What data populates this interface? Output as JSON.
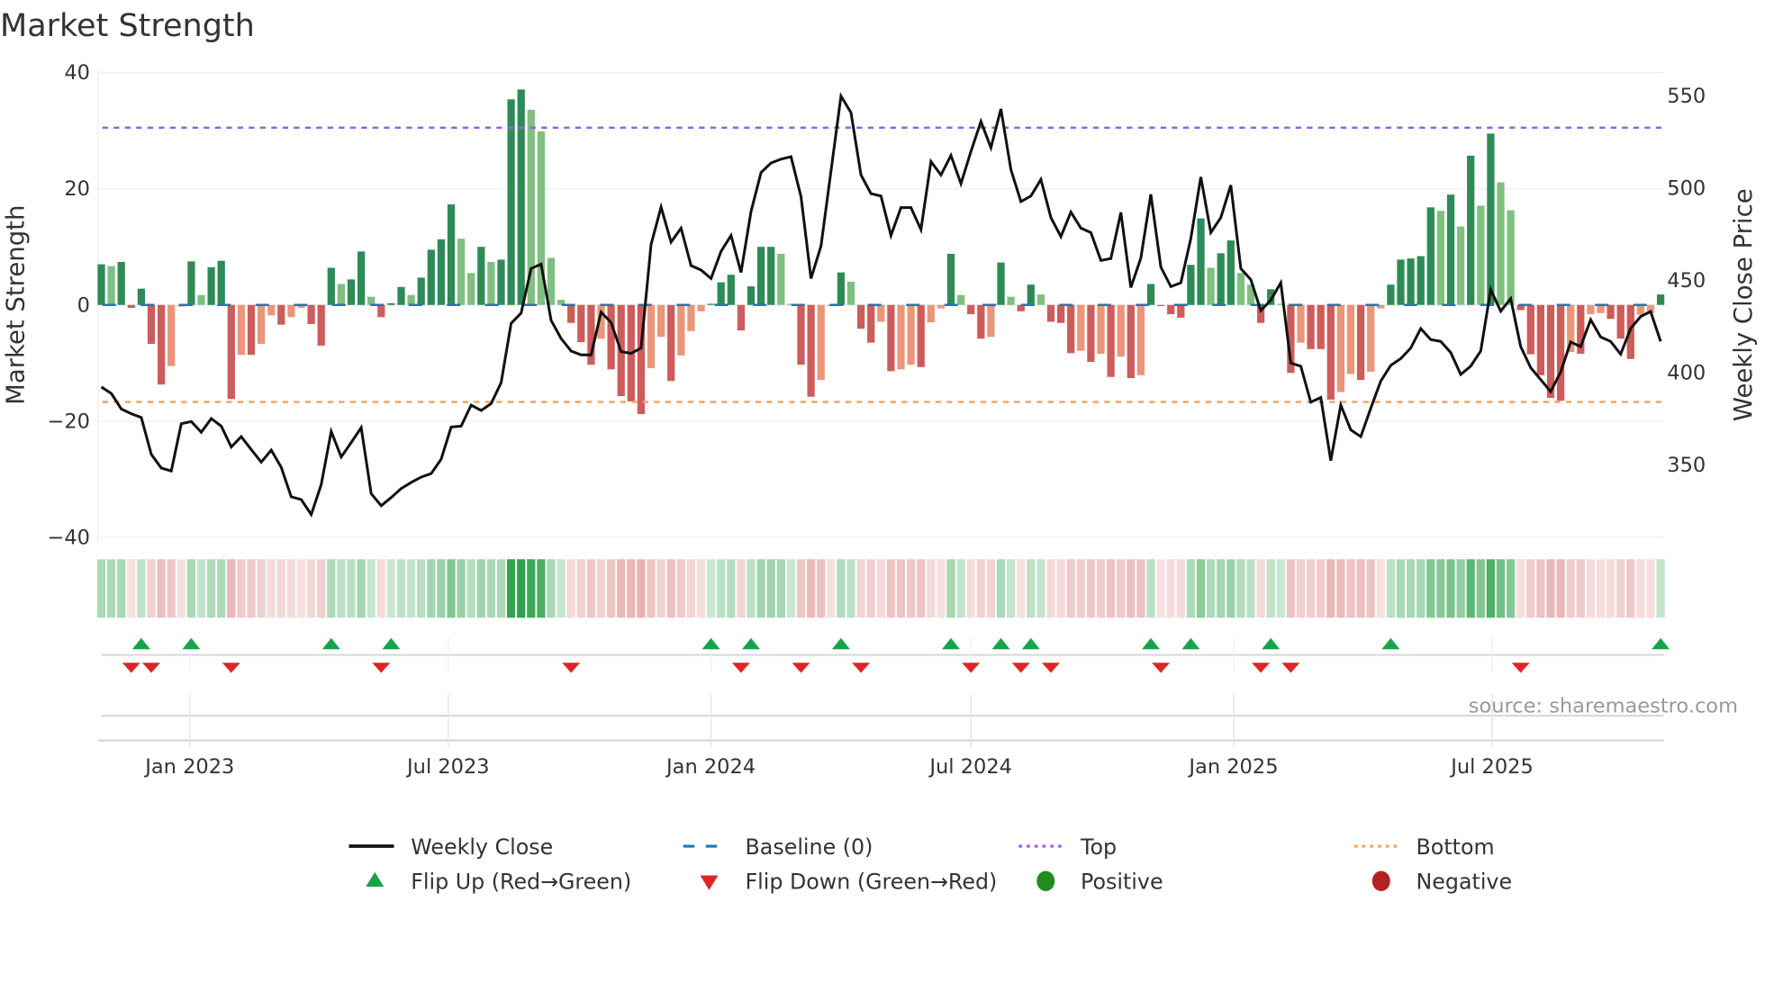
{
  "title": "Market Strength",
  "source": "source: sharemaestro.com",
  "colors": {
    "pos_strong": "#2e8b57",
    "pos_weak": "#7fbf7f",
    "neg_strong": "#cd5c5c",
    "neg_weak": "#e9967a",
    "close": "#111111",
    "baseline": "#1f77b4",
    "top": "#9b5de5",
    "bottom": "#f4a460",
    "flip_up": "#16a34a",
    "flip_down": "#dc2626",
    "positive": "#228b22",
    "negative": "#b22222"
  },
  "chart_data": {
    "type": "bar+line",
    "title": "Market Strength",
    "ylabel": "Market Strength",
    "y2label": "Weekly Close Price",
    "ylim": [
      -40,
      40
    ],
    "y2lim": [
      310,
      562
    ],
    "yticks": [
      40,
      20,
      0,
      -20,
      -40
    ],
    "yticklabels": [
      "40",
      "20",
      "0",
      "−20",
      "−40"
    ],
    "y2ticks": [
      550,
      500,
      450,
      400,
      350
    ],
    "y2ticklabels": [
      "550",
      "500",
      "450",
      "400",
      "350"
    ],
    "x_start": "2022-10-31",
    "x_step_days": 7,
    "xticks": [
      {
        "date": "2023-01-01",
        "label": "Jan 2023"
      },
      {
        "date": "2023-07-01",
        "label": "Jul 2023"
      },
      {
        "date": "2024-01-01",
        "label": "Jan 2024"
      },
      {
        "date": "2024-07-01",
        "label": "Jul 2024"
      },
      {
        "date": "2025-01-01",
        "label": "Jan 2025"
      },
      {
        "date": "2025-07-01",
        "label": "Jul 2025"
      }
    ],
    "top": 30.5,
    "bottom": -16.7,
    "baseline": 0,
    "grid": true,
    "legend_placement": "bottom-center",
    "series": [
      {
        "name": "Market Strength",
        "type": "bar",
        "axis": "left",
        "values": [
          7.0,
          6.7,
          7.4,
          -0.5,
          2.8,
          -6.7,
          -13.7,
          -10.5,
          -0.3,
          7.5,
          1.7,
          6.5,
          7.6,
          -16.2,
          -8.6,
          -8.6,
          -6.7,
          -1.8,
          -3.4,
          -2.1,
          -0.5,
          -3.3,
          -7.0,
          6.4,
          3.6,
          4.4,
          9.2,
          1.4,
          -2.1,
          0.3,
          3.1,
          1.7,
          4.7,
          9.5,
          11.3,
          17.3,
          11.4,
          5.5,
          10.0,
          7.4,
          7.8,
          35.4,
          37.1,
          33.6,
          29.9,
          8.1,
          0.9,
          -3.1,
          -6.4,
          -10.3,
          -5.8,
          -11.1,
          -15.7,
          -16.6,
          -18.8,
          -10.9,
          -5.5,
          -13.1,
          -8.7,
          -4.5,
          -1.1,
          0.2,
          3.9,
          5.2,
          -4.4,
          3.2,
          10.0,
          10.0,
          8.8,
          0.2,
          -10.3,
          -15.8,
          -12.9,
          -0.2,
          5.6,
          4.0,
          -4.1,
          -6.5,
          -2.9,
          -11.4,
          -11.1,
          -10.3,
          -10.7,
          -3.0,
          -0.6,
          8.8,
          1.7,
          -1.6,
          -5.8,
          -5.5,
          7.3,
          1.4,
          -1.1,
          3.5,
          1.8,
          -2.9,
          -3.1,
          -8.3,
          -7.9,
          -9.8,
          -8.4,
          -12.4,
          -8.9,
          -12.6,
          -12.1,
          3.6,
          -0.2,
          -1.6,
          -2.2,
          6.9,
          14.9,
          6.4,
          8.9,
          11.1,
          5.5,
          3.5,
          -3.1,
          2.7,
          0.2,
          -11.7,
          -6.5,
          -7.6,
          -7.6,
          -16.3,
          -15.0,
          -11.9,
          -12.9,
          -11.5,
          -0.6,
          3.5,
          7.8,
          8.0,
          8.4,
          16.8,
          16.2,
          19.0,
          13.5,
          25.7,
          17.1,
          29.5,
          21.1,
          16.3,
          -0.9,
          -8.5,
          -12.1,
          -16.0,
          -16.5,
          -8.1,
          -8.4,
          -1.6,
          -1.4,
          -2.4,
          -5.8,
          -9.3,
          -1.7,
          -1.4,
          1.8
        ]
      },
      {
        "name": "Weekly Close",
        "type": "line",
        "axis": "right",
        "values": [
          391.5,
          388,
          379.6,
          377,
          375,
          355,
          347.6,
          346,
          371.6,
          372.8,
          367,
          374.4,
          370.3,
          359,
          364.6,
          357.6,
          350.8,
          357.3,
          348,
          332,
          330.5,
          322.4,
          338.6,
          367.4,
          353.6,
          361.4,
          369.5,
          333.7,
          327.2,
          331.6,
          336.5,
          339.8,
          342.7,
          344.6,
          352.4,
          369.8,
          370.3,
          381.7,
          378.8,
          382.5,
          393.9,
          426,
          431.6,
          455.7,
          458.1,
          427.6,
          417.8,
          411,
          408.9,
          408.9,
          432.1,
          426.4,
          410.7,
          409.7,
          412.6,
          468.7,
          489,
          470,
          477.6,
          457.3,
          454.9,
          450.3,
          465,
          473.6,
          453.6,
          486.6,
          507.7,
          512.9,
          515,
          516.3,
          494.7,
          450.3,
          467.9,
          508.5,
          549.2,
          540.2,
          506.4,
          496.3,
          495,
          473.6,
          488.7,
          488.7,
          476.8,
          513.7,
          506.4,
          517,
          501.7,
          519.1,
          535.4,
          521.2,
          542.2,
          509.3,
          492,
          495,
          504,
          483.3,
          473,
          486.3,
          477.6,
          475.2,
          460.1,
          461.1,
          486.1,
          445.4,
          461.4,
          495.9,
          456.5,
          445.9,
          448,
          472,
          505.3,
          475.2,
          483.3,
          500.9,
          455.7,
          449.7,
          432.9,
          438.6,
          448,
          404.5,
          402.8,
          383.3,
          385.8,
          351.6,
          381.7,
          368.3,
          364.6,
          380,
          394.7,
          403.2,
          406.9,
          412.6,
          423.2,
          417.2,
          416.2,
          410.2,
          398.3,
          402.8,
          411,
          444.3,
          432.6,
          439.4,
          413.4,
          402,
          395.5,
          389,
          399.6,
          415.9,
          413.4,
          428,
          418.6,
          416.2,
          409.3,
          423.2,
          429.7,
          432.4,
          416.2
        ]
      }
    ]
  },
  "legend": [
    {
      "label": "Weekly Close",
      "marker": "solid-line"
    },
    {
      "label": "Baseline (0)",
      "marker": "dashed-line"
    },
    {
      "label": "Top",
      "marker": "dotted-line"
    },
    {
      "label": "Bottom",
      "marker": "dotted-line"
    },
    {
      "label": "Flip Up (Red→Green)",
      "marker": "triangle-up"
    },
    {
      "label": "Flip Down (Green→Red)",
      "marker": "triangle-down"
    },
    {
      "label": "Positive",
      "marker": "circle"
    },
    {
      "label": "Negative",
      "marker": "circle"
    }
  ]
}
